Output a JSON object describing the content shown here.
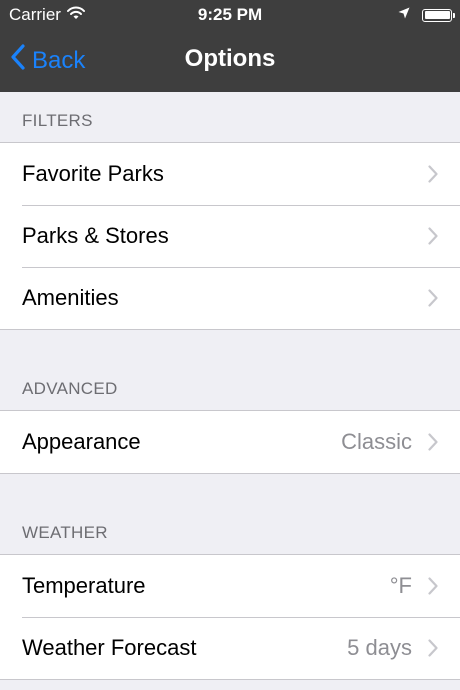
{
  "status_bar": {
    "carrier": "Carrier",
    "time": "9:25 PM",
    "icons": [
      "wifi-icon",
      "location-arrow-icon",
      "battery-icon"
    ]
  },
  "nav_bar": {
    "back_label": "Back",
    "title": "Options",
    "back_color": "#1a82fb",
    "bar_color": "#3e3e3e"
  },
  "sections": {
    "filters": {
      "header": "FILTERS",
      "rows": [
        {
          "label": "Favorite Parks",
          "value": ""
        },
        {
          "label": "Parks & Stores",
          "value": ""
        },
        {
          "label": "Amenities",
          "value": ""
        }
      ]
    },
    "advanced": {
      "header": "ADVANCED",
      "rows": [
        {
          "label": "Appearance",
          "value": "Classic"
        }
      ]
    },
    "weather": {
      "header": "WEATHER",
      "rows": [
        {
          "label": "Temperature",
          "value": "°F"
        },
        {
          "label": "Weather Forecast",
          "value": "5 days"
        }
      ]
    }
  }
}
